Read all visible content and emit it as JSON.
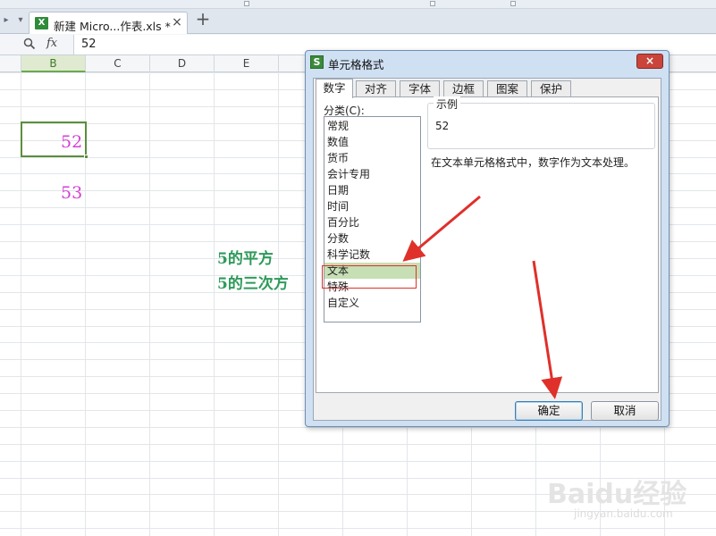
{
  "app": {
    "tab_title": "新建 Micro...作表.xls *",
    "tab_close": "×",
    "add_tab": "+"
  },
  "formula_bar": {
    "fx_label": "fx",
    "value": "52"
  },
  "columns": [
    "B",
    "C",
    "D",
    "E"
  ],
  "active_column": "B",
  "cells": {
    "b_selected": "52",
    "b_next": "53",
    "note_square": "5的平方",
    "note_cube": "5的三次方",
    "value_color": "#d63fd6",
    "note_color": "#2e9a5a"
  },
  "dialog": {
    "title": "单元格格式",
    "close_label": "×",
    "tabs": [
      "数字",
      "对齐",
      "字体",
      "边框",
      "图案",
      "保护"
    ],
    "active_tab": "数字",
    "category_label": "分类(C):",
    "categories": [
      "常规",
      "数值",
      "货币",
      "会计专用",
      "日期",
      "时间",
      "百分比",
      "分数",
      "科学记数",
      "文本",
      "特殊",
      "自定义"
    ],
    "selected_category": "文本",
    "sample_label": "示例",
    "sample_value": "52",
    "description": "在文本单元格格式中，数字作为文本处理。",
    "ok_label": "确定",
    "cancel_label": "取消"
  },
  "watermark": {
    "brand": "Baidu经验",
    "url": "jingyan.baidu.com"
  },
  "colors": {
    "accent_green": "#5a8f3c",
    "annotation_red": "#e0302a",
    "selection_fill": "#c6dfb4"
  }
}
